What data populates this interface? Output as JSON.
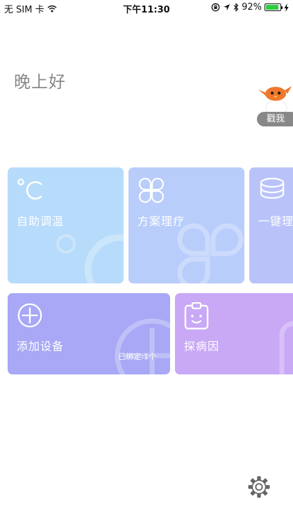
{
  "status_bar": {
    "carrier": "无 SIM 卡",
    "time": "下午11:30",
    "battery_percent": "92%",
    "battery_level": 0.92,
    "icons": [
      "wifi-icon",
      "orientation-lock-icon",
      "location-arrow-icon",
      "bluetooth-icon",
      "battery-icon",
      "charging-bolt-icon"
    ]
  },
  "greeting": "晚上好",
  "mascot": {
    "label": "戳我",
    "icon": "bird-mascot-icon"
  },
  "cards": {
    "temp": {
      "label": "自助调温",
      "icon": "celsius-icon",
      "color": "#b7dbfa"
    },
    "plan": {
      "label": "方案理疗",
      "icon": "clover-icon",
      "color": "#b9cdfb"
    },
    "onekey": {
      "label": "一键理疗",
      "icon": "stack-icon",
      "color": "#bac3f9"
    },
    "add": {
      "label": "添加设备",
      "icon": "plus-circle-icon",
      "color": "#a8a8f6",
      "bound": "已绑定:1个"
    },
    "probe": {
      "label": "探病因",
      "icon": "clipboard-smile-icon",
      "color": "#c9a8f6"
    }
  },
  "settings": {
    "icon": "gear-icon"
  }
}
